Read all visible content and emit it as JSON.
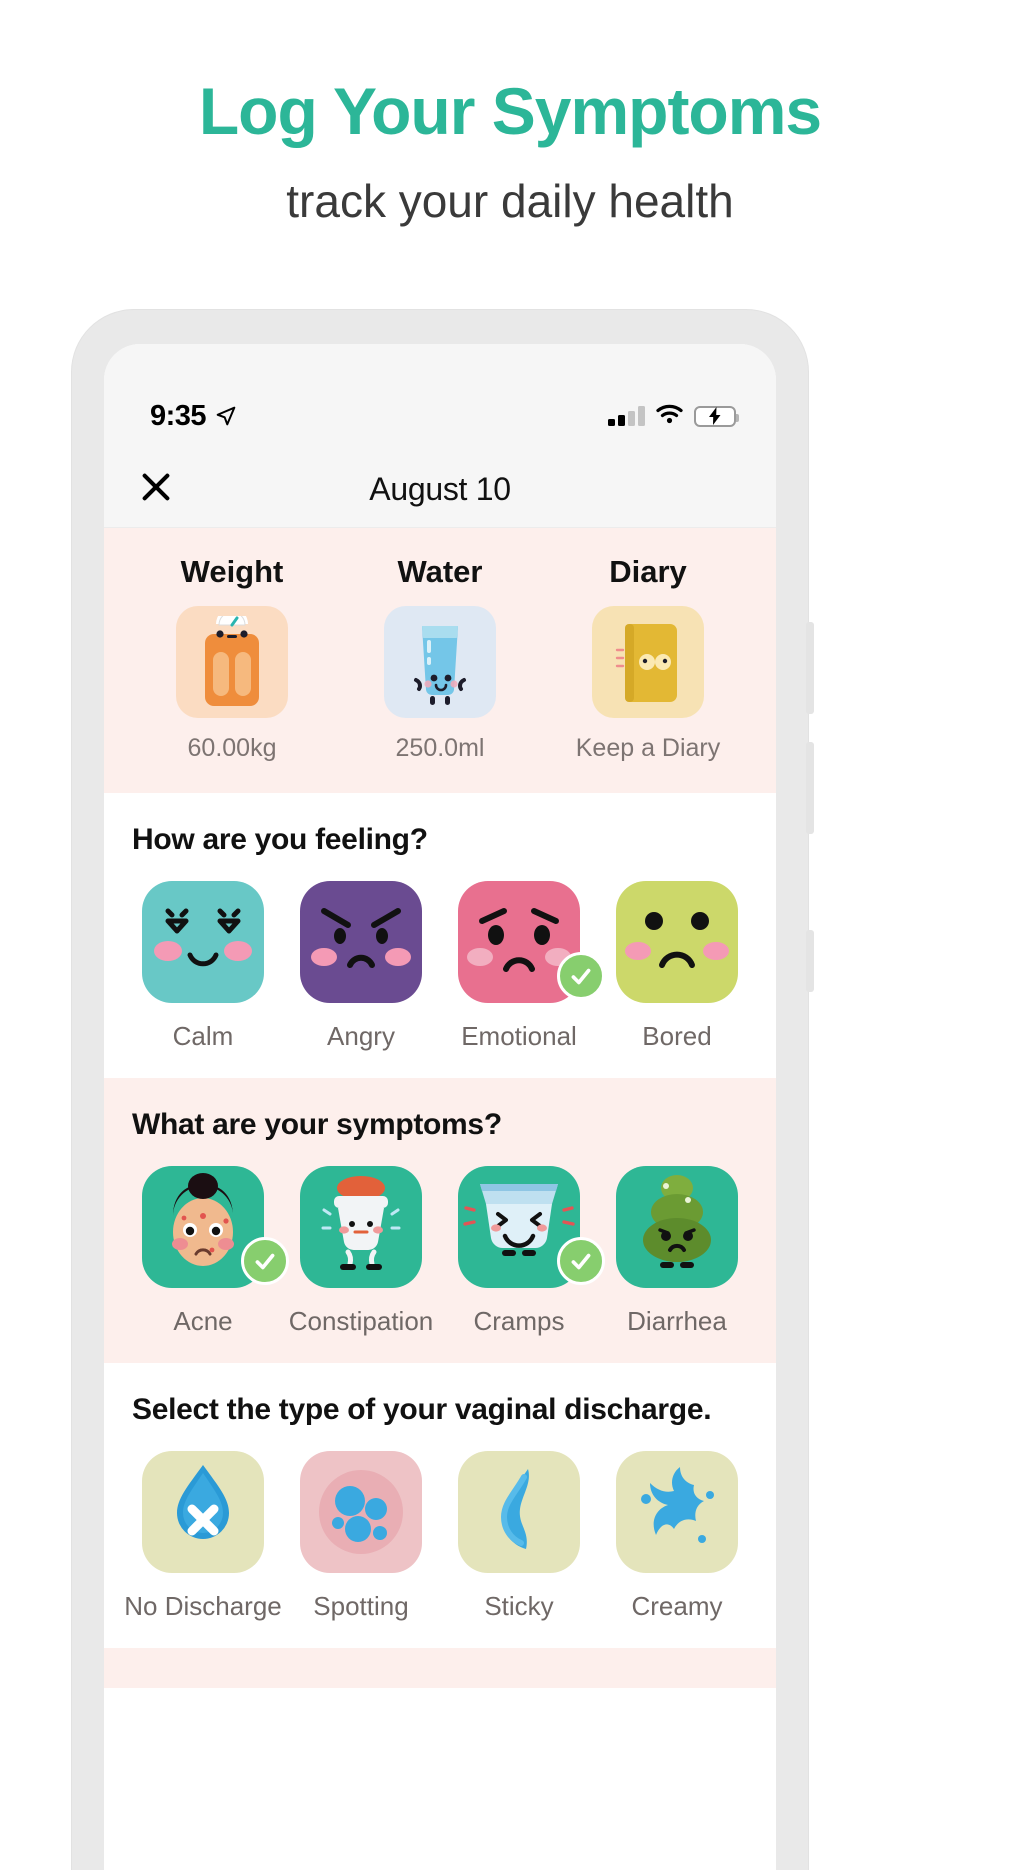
{
  "promo": {
    "title": "Log Your Symptoms",
    "subtitle": "track your daily health",
    "accent_color": "#2cb698"
  },
  "status_bar": {
    "time": "9:35",
    "location_icon": "location-arrow-icon",
    "signal_icon": "cellular-signal-icon",
    "wifi_icon": "wifi-icon",
    "battery_icon": "battery-charging-icon",
    "battery_color": "#3fd24a"
  },
  "nav": {
    "close_icon": "close-icon",
    "title": "August 10"
  },
  "metrics": {
    "items": [
      {
        "title": "Weight",
        "value": "60.00kg",
        "icon": "weight-scale-icon",
        "tile_color": "#fbdcc2"
      },
      {
        "title": "Water",
        "value": "250.0ml",
        "icon": "water-glass-icon",
        "tile_color": "#dfe8f3"
      },
      {
        "title": "Diary",
        "value": "Keep a Diary",
        "icon": "diary-book-icon",
        "tile_color": "#f7e2b4"
      }
    ]
  },
  "mood": {
    "heading": "How are you feeling?",
    "items": [
      {
        "label": "Calm",
        "icon": "mood-calm-icon",
        "tile_color": "#68c8c6",
        "selected": false
      },
      {
        "label": "Angry",
        "icon": "mood-angry-icon",
        "tile_color": "#6a4b91",
        "selected": false
      },
      {
        "label": "Emotional",
        "icon": "mood-emotional-icon",
        "tile_color": "#e8708f",
        "selected": true
      },
      {
        "label": "Bored",
        "icon": "mood-bored-icon",
        "tile_color": "#ccd86a",
        "selected": false
      }
    ]
  },
  "symptoms": {
    "heading": "What are your symptoms?",
    "items": [
      {
        "label": "Acne",
        "icon": "symptom-acne-icon",
        "tile_color": "#2eb795",
        "selected": true
      },
      {
        "label": "Constipation",
        "icon": "symptom-constipation-icon",
        "tile_color": "#2eb795",
        "selected": false
      },
      {
        "label": "Cramps",
        "icon": "symptom-cramps-icon",
        "tile_color": "#2eb795",
        "selected": true
      },
      {
        "label": "Diarrhea",
        "icon": "symptom-diarrhea-icon",
        "tile_color": "#2eb795",
        "selected": false
      }
    ]
  },
  "discharge": {
    "heading": "Select the type of your vaginal discharge.",
    "items": [
      {
        "label": "No Discharge",
        "icon": "discharge-none-icon",
        "tile_color": "#e4e4bb",
        "selected": false
      },
      {
        "label": "Spotting",
        "icon": "discharge-spotting-icon",
        "tile_color": "#eec3c6",
        "selected": false
      },
      {
        "label": "Sticky",
        "icon": "discharge-sticky-icon",
        "tile_color": "#e4e4bb",
        "selected": false
      },
      {
        "label": "Creamy",
        "icon": "discharge-creamy-icon",
        "tile_color": "#e4e4bb",
        "selected": false
      }
    ]
  },
  "colors": {
    "section_pink": "#fdefec",
    "check_green": "#87ce6e"
  }
}
